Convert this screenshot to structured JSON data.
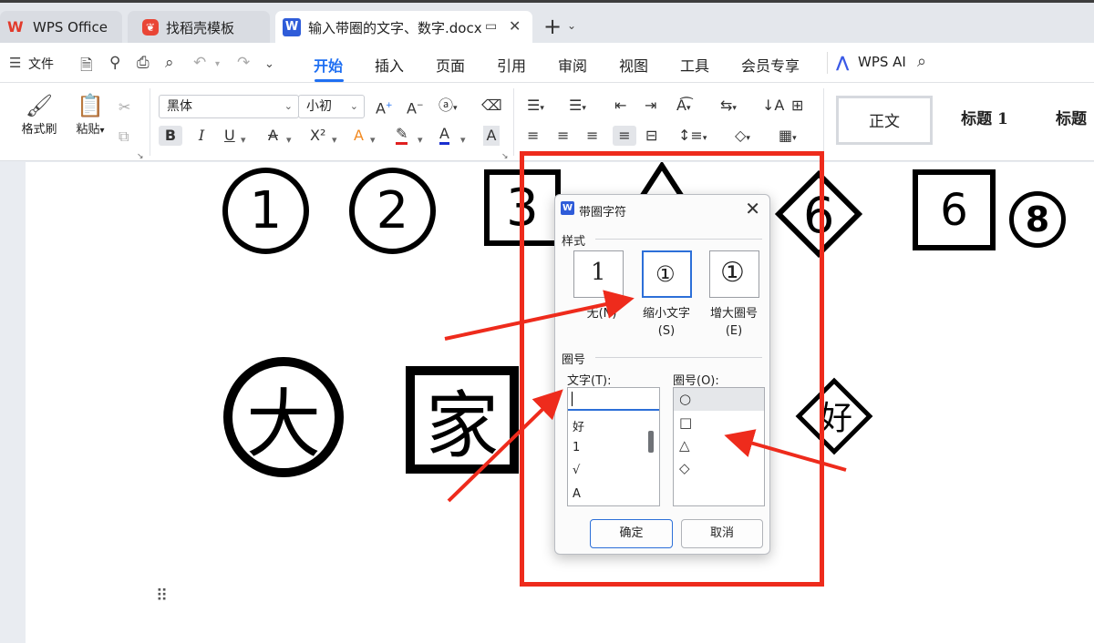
{
  "tabs": {
    "wps_office": "WPS Office",
    "template": "找稻壳模板",
    "document": "输入带圈的文字、数字.docx",
    "new_tab": "+"
  },
  "menubar": {
    "file": "文件",
    "items": [
      "开始",
      "插入",
      "页面",
      "引用",
      "审阅",
      "视图",
      "工具",
      "会员专享"
    ],
    "wps_ai": "WPS AI"
  },
  "ribbon": {
    "format_painter": "格式刷",
    "paste": "粘贴",
    "font_name": "黑体",
    "font_size": "小初",
    "bold": "B",
    "italic": "I",
    "underline": "U",
    "superscript": "X²",
    "styles": [
      "正文",
      "标题 1",
      "标题"
    ]
  },
  "document": {
    "row1": [
      "①",
      "②",
      "3",
      "△",
      "6",
      "6",
      "⑧"
    ],
    "row2": [
      "大",
      "家",
      "好"
    ]
  },
  "dialog": {
    "title": "带圈字符",
    "style_group": "样式",
    "style_options": [
      {
        "label": "无(N)",
        "sample": "1"
      },
      {
        "label": "缩小文字\n(S)",
        "sample": "①"
      },
      {
        "label": "增大圈号\n(E)",
        "sample": "①"
      }
    ],
    "circle_group": "圈号",
    "text_label": "文字(T):",
    "text_value": "",
    "text_items": [
      "好",
      "1",
      "√",
      "A"
    ],
    "circle_label": "圈号(O):",
    "circle_items": [
      "○",
      "□",
      "△",
      "◇"
    ],
    "ok": "确定",
    "cancel": "取消"
  },
  "colors": {
    "accent": "#1f6ff2",
    "highlight": "#ee2b1c",
    "wps_red": "#e23a2b"
  }
}
